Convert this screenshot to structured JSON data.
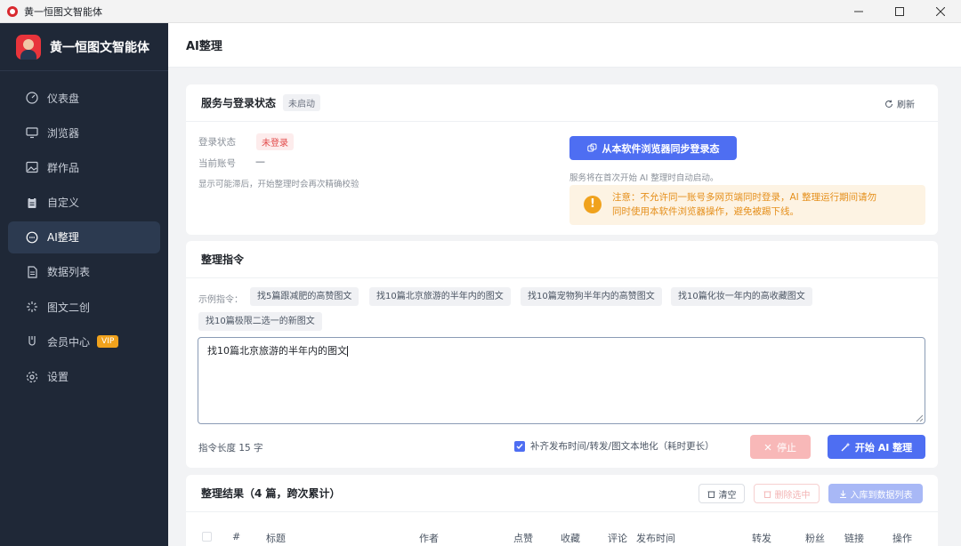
{
  "window": {
    "title": "黄一恒图文智能体"
  },
  "brand": {
    "name": "黄一恒图文智能体"
  },
  "nav": {
    "items": [
      {
        "label": "仪表盘",
        "icon": "dashboard-icon"
      },
      {
        "label": "浏览器",
        "icon": "monitor-icon"
      },
      {
        "label": "群作品",
        "icon": "image-icon"
      },
      {
        "label": "自定义",
        "icon": "clipboard-icon"
      },
      {
        "label": "AI整理",
        "icon": "chat-icon"
      },
      {
        "label": "数据列表",
        "icon": "document-icon"
      },
      {
        "label": "图文二创",
        "icon": "sparkle-icon"
      },
      {
        "label": "会员中心",
        "icon": "vip-icon"
      },
      {
        "label": "设置",
        "icon": "gear-icon"
      }
    ],
    "active": "AI整理",
    "vip_badge": "VIP"
  },
  "page": {
    "title": "AI整理"
  },
  "service": {
    "title": "服务与登录状态",
    "status_tag": "未启动",
    "refresh_label": "刷新",
    "login_label": "登录状态",
    "login_value": "未登录",
    "account_label": "当前账号",
    "account_value": "—",
    "hint": "显示可能滞后，开始整理时会再次精确校验",
    "sync_button": "从本软件浏览器同步登录态",
    "auto_start_note": "服务将在首次开始 AI 整理时自动启动。",
    "warning_line1": "注意：不允许同一账号多网页端同时登录，AI 整理运行期间请勿",
    "warning_line2": "同时使用本软件浏览器操作，避免被踢下线。"
  },
  "command": {
    "title": "整理指令",
    "examples_label": "示例指令：",
    "examples": [
      "找5篇跟减肥的高赞图文",
      "找10篇北京旅游的半年内的图文",
      "找10篇宠物狗半年内的高赞图文",
      "找10篇化妆一年内的高收藏图文",
      "找10篇极限二选一的新图文"
    ],
    "input_value": "找10篇北京旅游的半年内的图文",
    "length_text": "指令长度 15 字",
    "checkbox_label": "补齐发布时间/转发/图文本地化（耗时更长）",
    "stop_button": "停止",
    "start_button": "开始 AI 整理"
  },
  "results": {
    "title": "整理结果（4 篇，跨次累计）",
    "clear_button": "清空",
    "delete_button": "删除选中",
    "save_button": "入库到数据列表",
    "columns": [
      "#",
      "标题",
      "作者",
      "点赞",
      "收藏",
      "评论",
      "发布时间",
      "转发",
      "粉丝",
      "链接",
      "操作"
    ]
  },
  "colors": {
    "sidebar_bg": "#1f2837",
    "primary": "#4e6ef2",
    "warning": "#f0a21d",
    "danger": "#e24b4b"
  }
}
